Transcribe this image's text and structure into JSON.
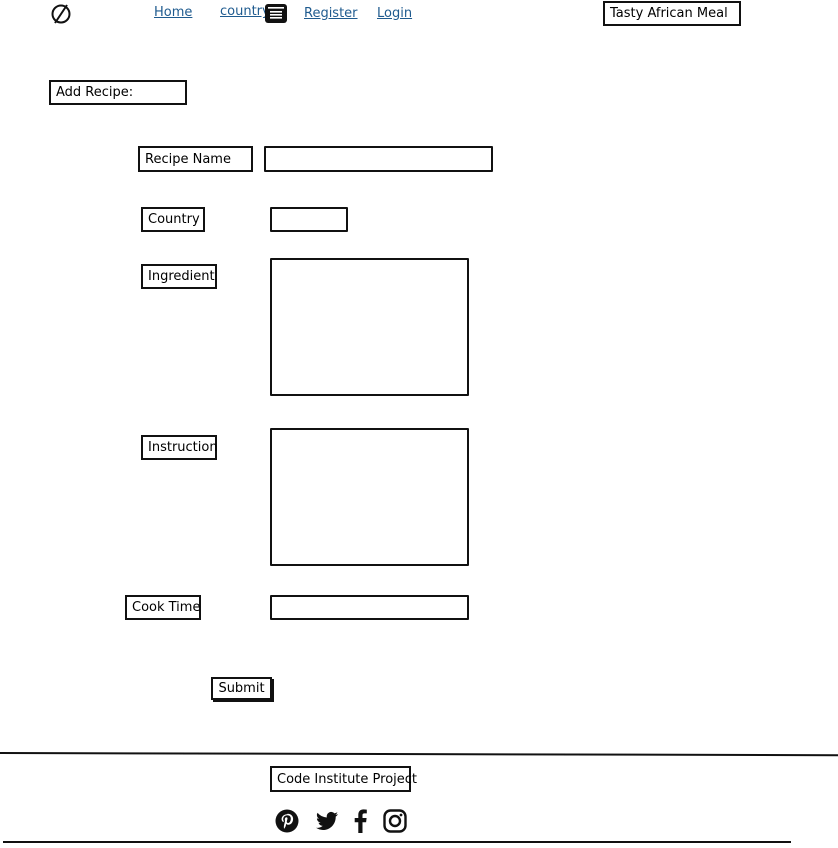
{
  "header": {
    "nav": {
      "home": "Home",
      "country": "country",
      "register": "Register",
      "login": "Login"
    },
    "brand": "Tasty African Meal",
    "logo_icon": "compass-icon",
    "menu_icon": "list-icon"
  },
  "main": {
    "section_title": "Add Recipe:",
    "form": {
      "recipe_name_label": "Recipe Name",
      "recipe_name_value": "",
      "country_label": "Country",
      "country_value": "",
      "ingredient_label": "Ingredient",
      "ingredient_value": "",
      "instruction_label": "Instruction",
      "instruction_value": "",
      "cook_time_label": "Cook Time",
      "cook_time_value": "",
      "submit_label": "Submit"
    }
  },
  "footer": {
    "project_label": "Code Institute Project",
    "social": [
      {
        "icon": "pinterest-icon"
      },
      {
        "icon": "twitter-icon"
      },
      {
        "icon": "facebook-icon"
      },
      {
        "icon": "instagram-icon"
      }
    ]
  },
  "colors": {
    "link": "#1f5b8f",
    "stroke": "#111111"
  }
}
